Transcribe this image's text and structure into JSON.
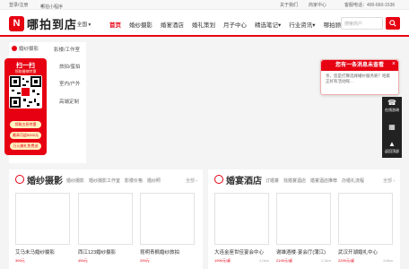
{
  "topbar": {
    "login": "登录/注册",
    "mini_program": "哪拍小程序",
    "about": "关于我们",
    "merchant": "商家中心",
    "hotline": "客服电话：400-660-1536"
  },
  "header": {
    "logo_mark": "N",
    "logo_text": "哪拍到店",
    "city": "全国",
    "nav": [
      "首页",
      "婚纱摄影",
      "婚宴酒店",
      "婚礼策划",
      "月子中心",
      "精选笔记",
      "行业资讯",
      "哪拍顾问"
    ],
    "search_placeholder": "搜索商户"
  },
  "left_menu": {
    "category": "婚纱摄影",
    "items": [
      "影楼/工作室",
      "旅拍/蜜拍",
      "室内/户外",
      "高端定制"
    ]
  },
  "qr_panel": {
    "title": "扫一扫",
    "subtitle": "领取婚嫁特惠",
    "perks": [
      "领取五折特惠",
      "最高可返5000元",
      "万元婚礼免费送"
    ]
  },
  "popup": {
    "title": "您有一条消息未查看",
    "close": "×",
    "body": "亲，您是打算选择婚纱服务呢？咱家正好有活动呢..."
  },
  "side_tools": [
    {
      "glyph": "☎",
      "label": "在线咨询"
    },
    {
      "glyph": "▦",
      "label": ""
    },
    {
      "glyph": "▲",
      "label": "返回顶部"
    }
  ],
  "sections": [
    {
      "title": "婚纱摄影",
      "tabs": [
        "婚纱摄影",
        "婚纱摄影工作室",
        "影楼价格",
        "婚纱照"
      ],
      "more": "全部 ›",
      "cards": [
        {
          "name": "艾马未马婚纱摄影",
          "price": "399元",
          "dist": ""
        },
        {
          "name": "西江123婚纱摄影",
          "price": "459元",
          "dist": ""
        },
        {
          "name": "昆明青枫婚纱旅拍",
          "price": "299元",
          "dist": ""
        }
      ]
    },
    {
      "title": "婚宴酒店",
      "tabs": [
        "订婚宴",
        "找婚宴酒店",
        "婚宴酒店推荐",
        "办婚礼流程"
      ],
      "more": "全部 ›",
      "cards": [
        {
          "name": "大连金座世佳宴会中心",
          "price": "1999元/桌",
          "dist": "4.0km"
        },
        {
          "name": "谢雄酒楼·宴会厅(蒲江)",
          "price": "2199元/桌",
          "dist": "2.3km"
        },
        {
          "name": "武汉开湖婚礼中心",
          "price": "2299元/桌",
          "dist": "3.8km"
        }
      ]
    }
  ],
  "colors": {
    "brand": "#e60012",
    "text": "#333333"
  }
}
